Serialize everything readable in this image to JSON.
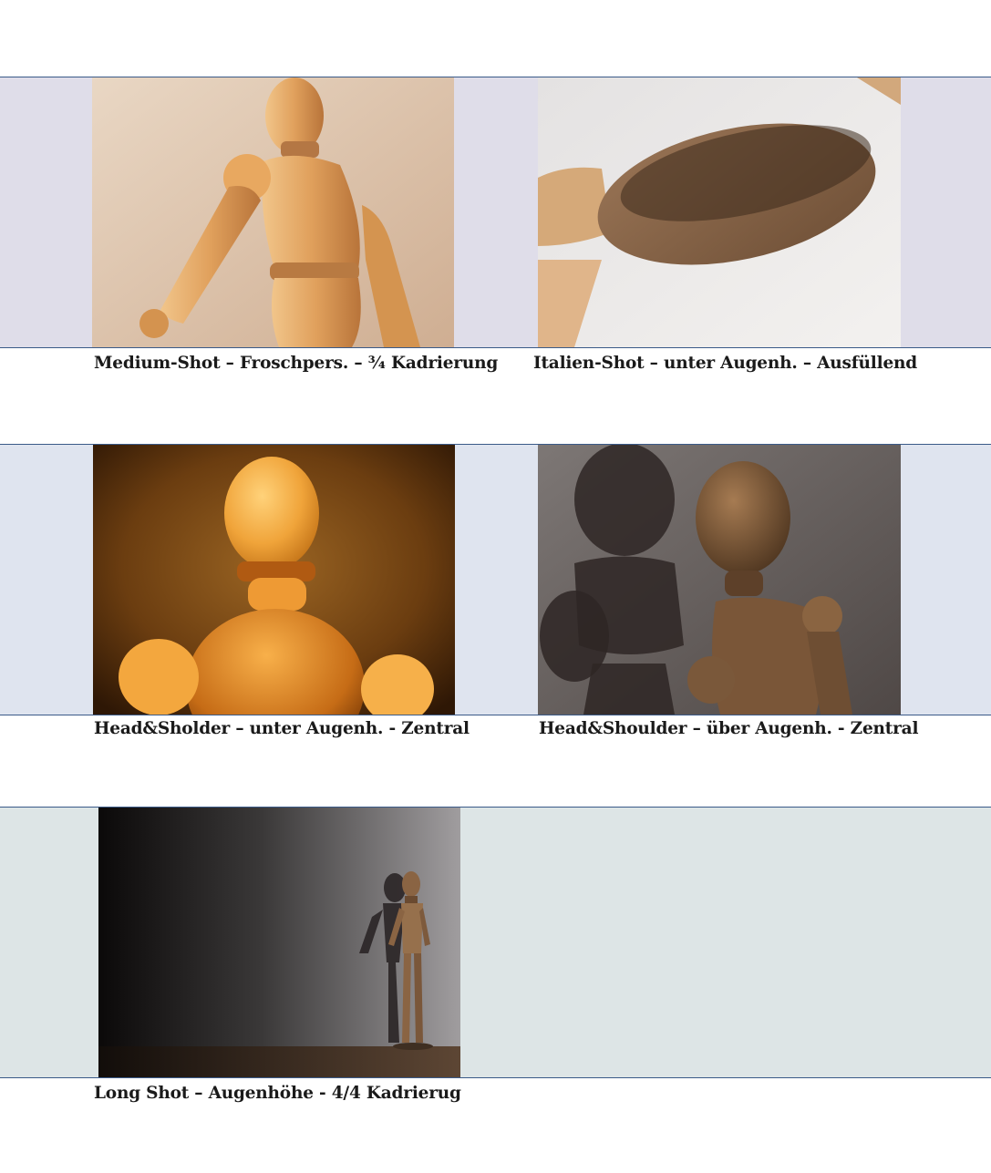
{
  "rows": [
    {
      "band_color": "#dfdde9",
      "items": [
        {
          "caption": "Medium-Shot – Froschpers. – ¾ Kadrierung",
          "alt": "Holzgliederpuppe, Oberkörper von unten"
        },
        {
          "caption": "Italien-Shot – unter Augenh. – Ausfüllend",
          "alt": "Holzgliederpuppe, Fuß in Nahaufnahme"
        }
      ]
    },
    {
      "band_color": "#dfe4ef",
      "items": [
        {
          "caption": "Head&Sholder – unter Augenh. - Zentral",
          "alt": "Holzgliederpuppe, Kopf und Schultern, warmes Licht"
        },
        {
          "caption": "Head&Shoulder – über Augenh. - Zentral",
          "alt": "Holzgliederpuppe mit Schatten an der Wand"
        }
      ]
    },
    {
      "band_color": "#dde5e6",
      "items": [
        {
          "caption": "Long Shot – Augenhöhe - 4/4 Kadrierug",
          "alt": "Holzgliederpuppe, ganze Figur vor Wand"
        }
      ]
    }
  ]
}
